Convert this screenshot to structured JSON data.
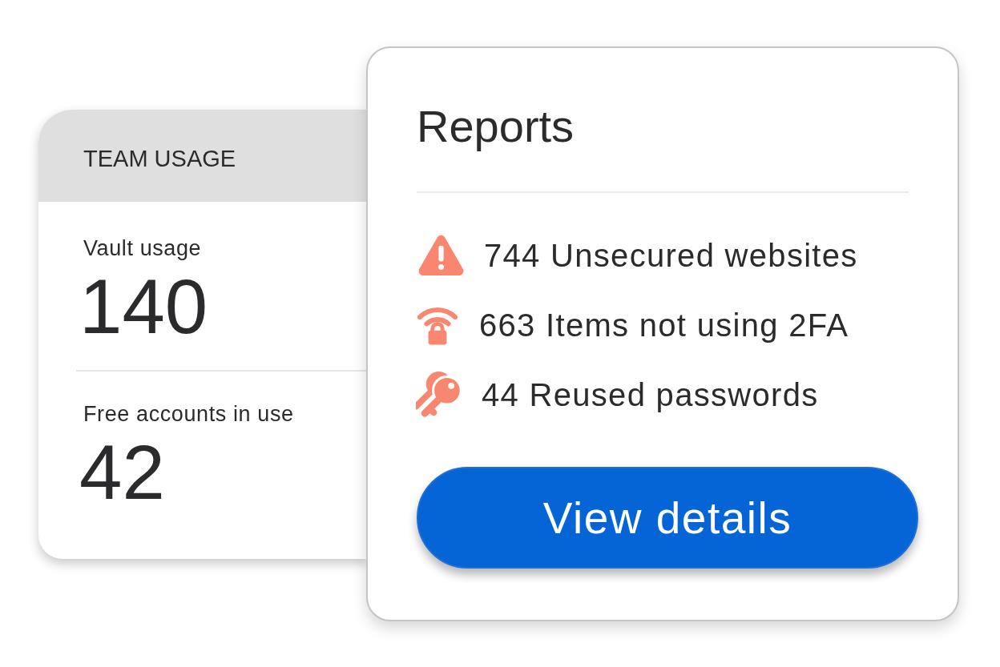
{
  "team_usage": {
    "title": "TEAM USAGE",
    "stats": [
      {
        "label": "Vault usage",
        "value": "140"
      },
      {
        "label": "Free accounts in use",
        "value": "42"
      }
    ]
  },
  "reports": {
    "title": "Reports",
    "items": [
      {
        "kind": "unsecured",
        "text": "744 Unsecured websites"
      },
      {
        "kind": "twofactor",
        "text": "663 Items not using 2FA"
      },
      {
        "kind": "reused",
        "text": "44 Reused passwords"
      }
    ],
    "button": "View details"
  }
}
